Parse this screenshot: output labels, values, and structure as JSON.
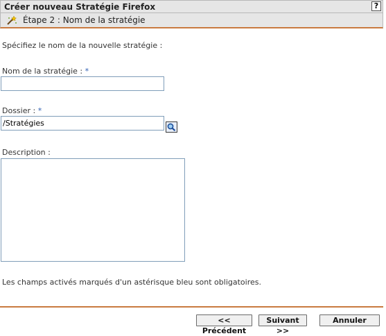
{
  "window": {
    "title": "Créer nouveau Stratégie Firefox",
    "help_label": "?"
  },
  "step": {
    "icon": "wand-icon",
    "label": "Étape 2 : Nom de la stratégie"
  },
  "intro_text": "Spécifiez le nom de la nouvelle stratégie :",
  "form": {
    "name": {
      "label": "Nom de la stratégie :",
      "required_mark": "*",
      "value": ""
    },
    "folder": {
      "label": "Dossier :",
      "required_mark": "*",
      "value": "/Stratégies",
      "browse_icon": "search-icon"
    },
    "description": {
      "label": "Description :",
      "value": ""
    }
  },
  "required_note": "Les champs activés marqués d'un astérisque bleu sont obligatoires.",
  "buttons": {
    "previous": "<< Précédent",
    "next": "Suivant >>",
    "cancel": "Annuler"
  },
  "colors": {
    "accent_rule": "#c97a3f",
    "required": "#2f5fb3",
    "header_bg": "#e6e6e6"
  }
}
